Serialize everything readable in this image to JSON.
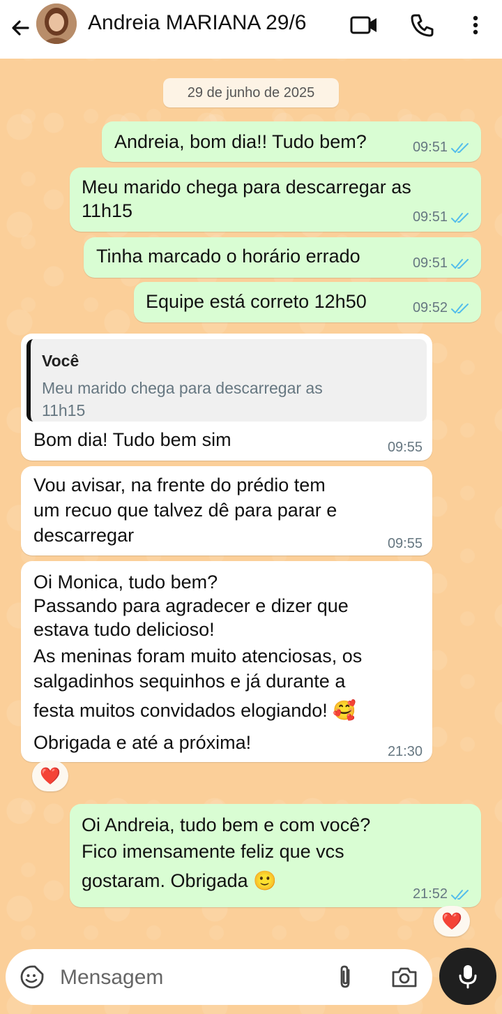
{
  "header": {
    "contact_name": "Andreia MARIANA 29/6"
  },
  "date_chip": "29 de junho de 2025",
  "messages": [
    {
      "type": "out",
      "lines": [
        "Andreia, bom dia!! Tudo bem?"
      ],
      "time": "09:51"
    },
    {
      "type": "out",
      "lines": [
        "Meu marido chega para descarregar as",
        "11h15"
      ],
      "time": "09:51"
    },
    {
      "type": "out",
      "lines": [
        "Tinha marcado o horário errado"
      ],
      "time": "09:51"
    },
    {
      "type": "out",
      "lines": [
        "Equipe está correto 12h50"
      ],
      "time": "09:52"
    },
    {
      "type": "in",
      "quote": {
        "author": "Você",
        "lines": [
          "Meu marido chega para descarregar as",
          "11h15"
        ]
      },
      "lines": [
        "Bom dia! Tudo bem sim"
      ],
      "time": "09:55"
    },
    {
      "type": "in",
      "lines": [
        "Vou avisar, na frente do prédio tem",
        "um recuo que talvez dê para parar e",
        "descarregar"
      ],
      "time": "09:55"
    },
    {
      "type": "in",
      "lines": [
        "Oi Monica, tudo bem?",
        "Passando para agradecer e dizer que",
        "estava tudo delicioso!",
        "As meninas foram muito atenciosas, os",
        "salgadinhos sequinhos e já durante a",
        "festa muitos convidados elogiando! 🥰",
        "Obrigada e até a próxima!"
      ],
      "time": "21:30",
      "reaction": "❤️"
    },
    {
      "type": "out",
      "lines": [
        "Oi Andreia, tudo bem e com você?",
        "Fico imensamente feliz que vcs",
        "gostaram. Obrigada 🙂"
      ],
      "time": "21:52",
      "reaction": "❤️"
    }
  ],
  "input": {
    "placeholder": "Mensagem"
  },
  "colors": {
    "outgoing_bubble": "#d9fdd3",
    "incoming_bubble": "#ffffff",
    "read_ticks": "#53bdeb",
    "wallpaper": "#fbcf99"
  }
}
